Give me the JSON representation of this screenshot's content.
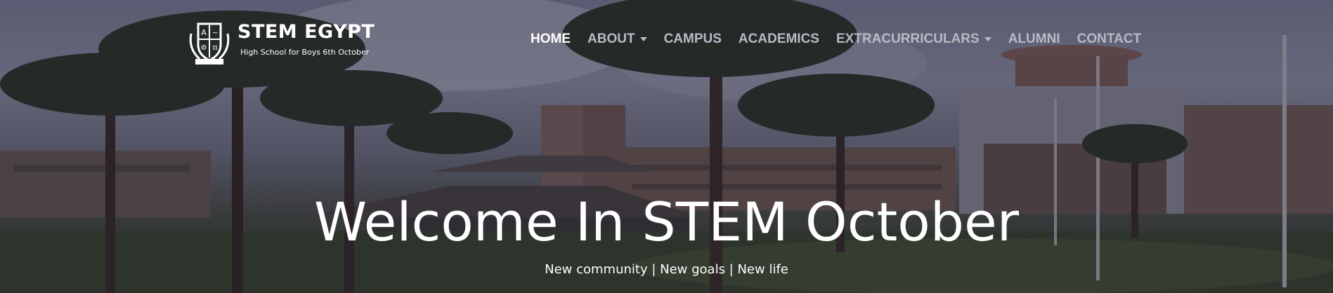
{
  "brand": {
    "title": "STEM EGYPT",
    "subtitle": "High School for Boys 6th October",
    "logo_icon": "school-crest-icon"
  },
  "nav": {
    "items": [
      {
        "label": "HOME",
        "active": true,
        "dropdown": false
      },
      {
        "label": "ABOUT",
        "active": false,
        "dropdown": true
      },
      {
        "label": "CAMPUS",
        "active": false,
        "dropdown": false
      },
      {
        "label": "ACADEMICS",
        "active": false,
        "dropdown": false
      },
      {
        "label": "EXTRACURRICULARS",
        "active": false,
        "dropdown": true
      },
      {
        "label": "ALUMNI",
        "active": false,
        "dropdown": false
      },
      {
        "label": "CONTACT",
        "active": false,
        "dropdown": false
      }
    ]
  },
  "hero": {
    "title": "Welcome In STEM October",
    "subtitle": "New community | New goals | New life"
  },
  "colors": {
    "text": "#ffffff",
    "nav_inactive": "#b9b9c4",
    "overlay": "#19162a"
  }
}
